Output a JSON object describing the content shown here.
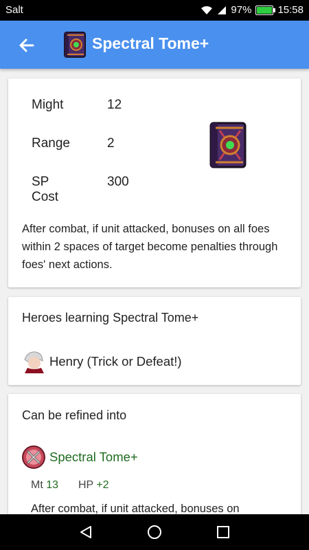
{
  "status_bar": {
    "carrier": "Salt",
    "battery": "97%",
    "time": "15:58"
  },
  "app_bar": {
    "title": "Spectral Tome+"
  },
  "stats": [
    {
      "label": "Might",
      "value": "12"
    },
    {
      "label": "Range",
      "value": "2"
    },
    {
      "label": "SP Cost",
      "value": "300"
    }
  ],
  "description": "After combat, if unit attacked, bonuses on all foes within 2 spaces of target become penalties through foes' next actions.",
  "heroes": {
    "title": "Heroes learning Spectral Tome+",
    "items": [
      {
        "name": "Henry (Trick or Defeat!)"
      }
    ]
  },
  "refine": {
    "title": "Can be refined into",
    "name": "Spectral Tome+",
    "mt_label": "Mt",
    "mt_value": "13",
    "hp_label": "HP",
    "hp_value": "+2",
    "description": "After combat, if unit attacked, bonuses on"
  },
  "colors": {
    "app_bar": "#4a90ee",
    "refine_green": "#1f6b1f"
  }
}
